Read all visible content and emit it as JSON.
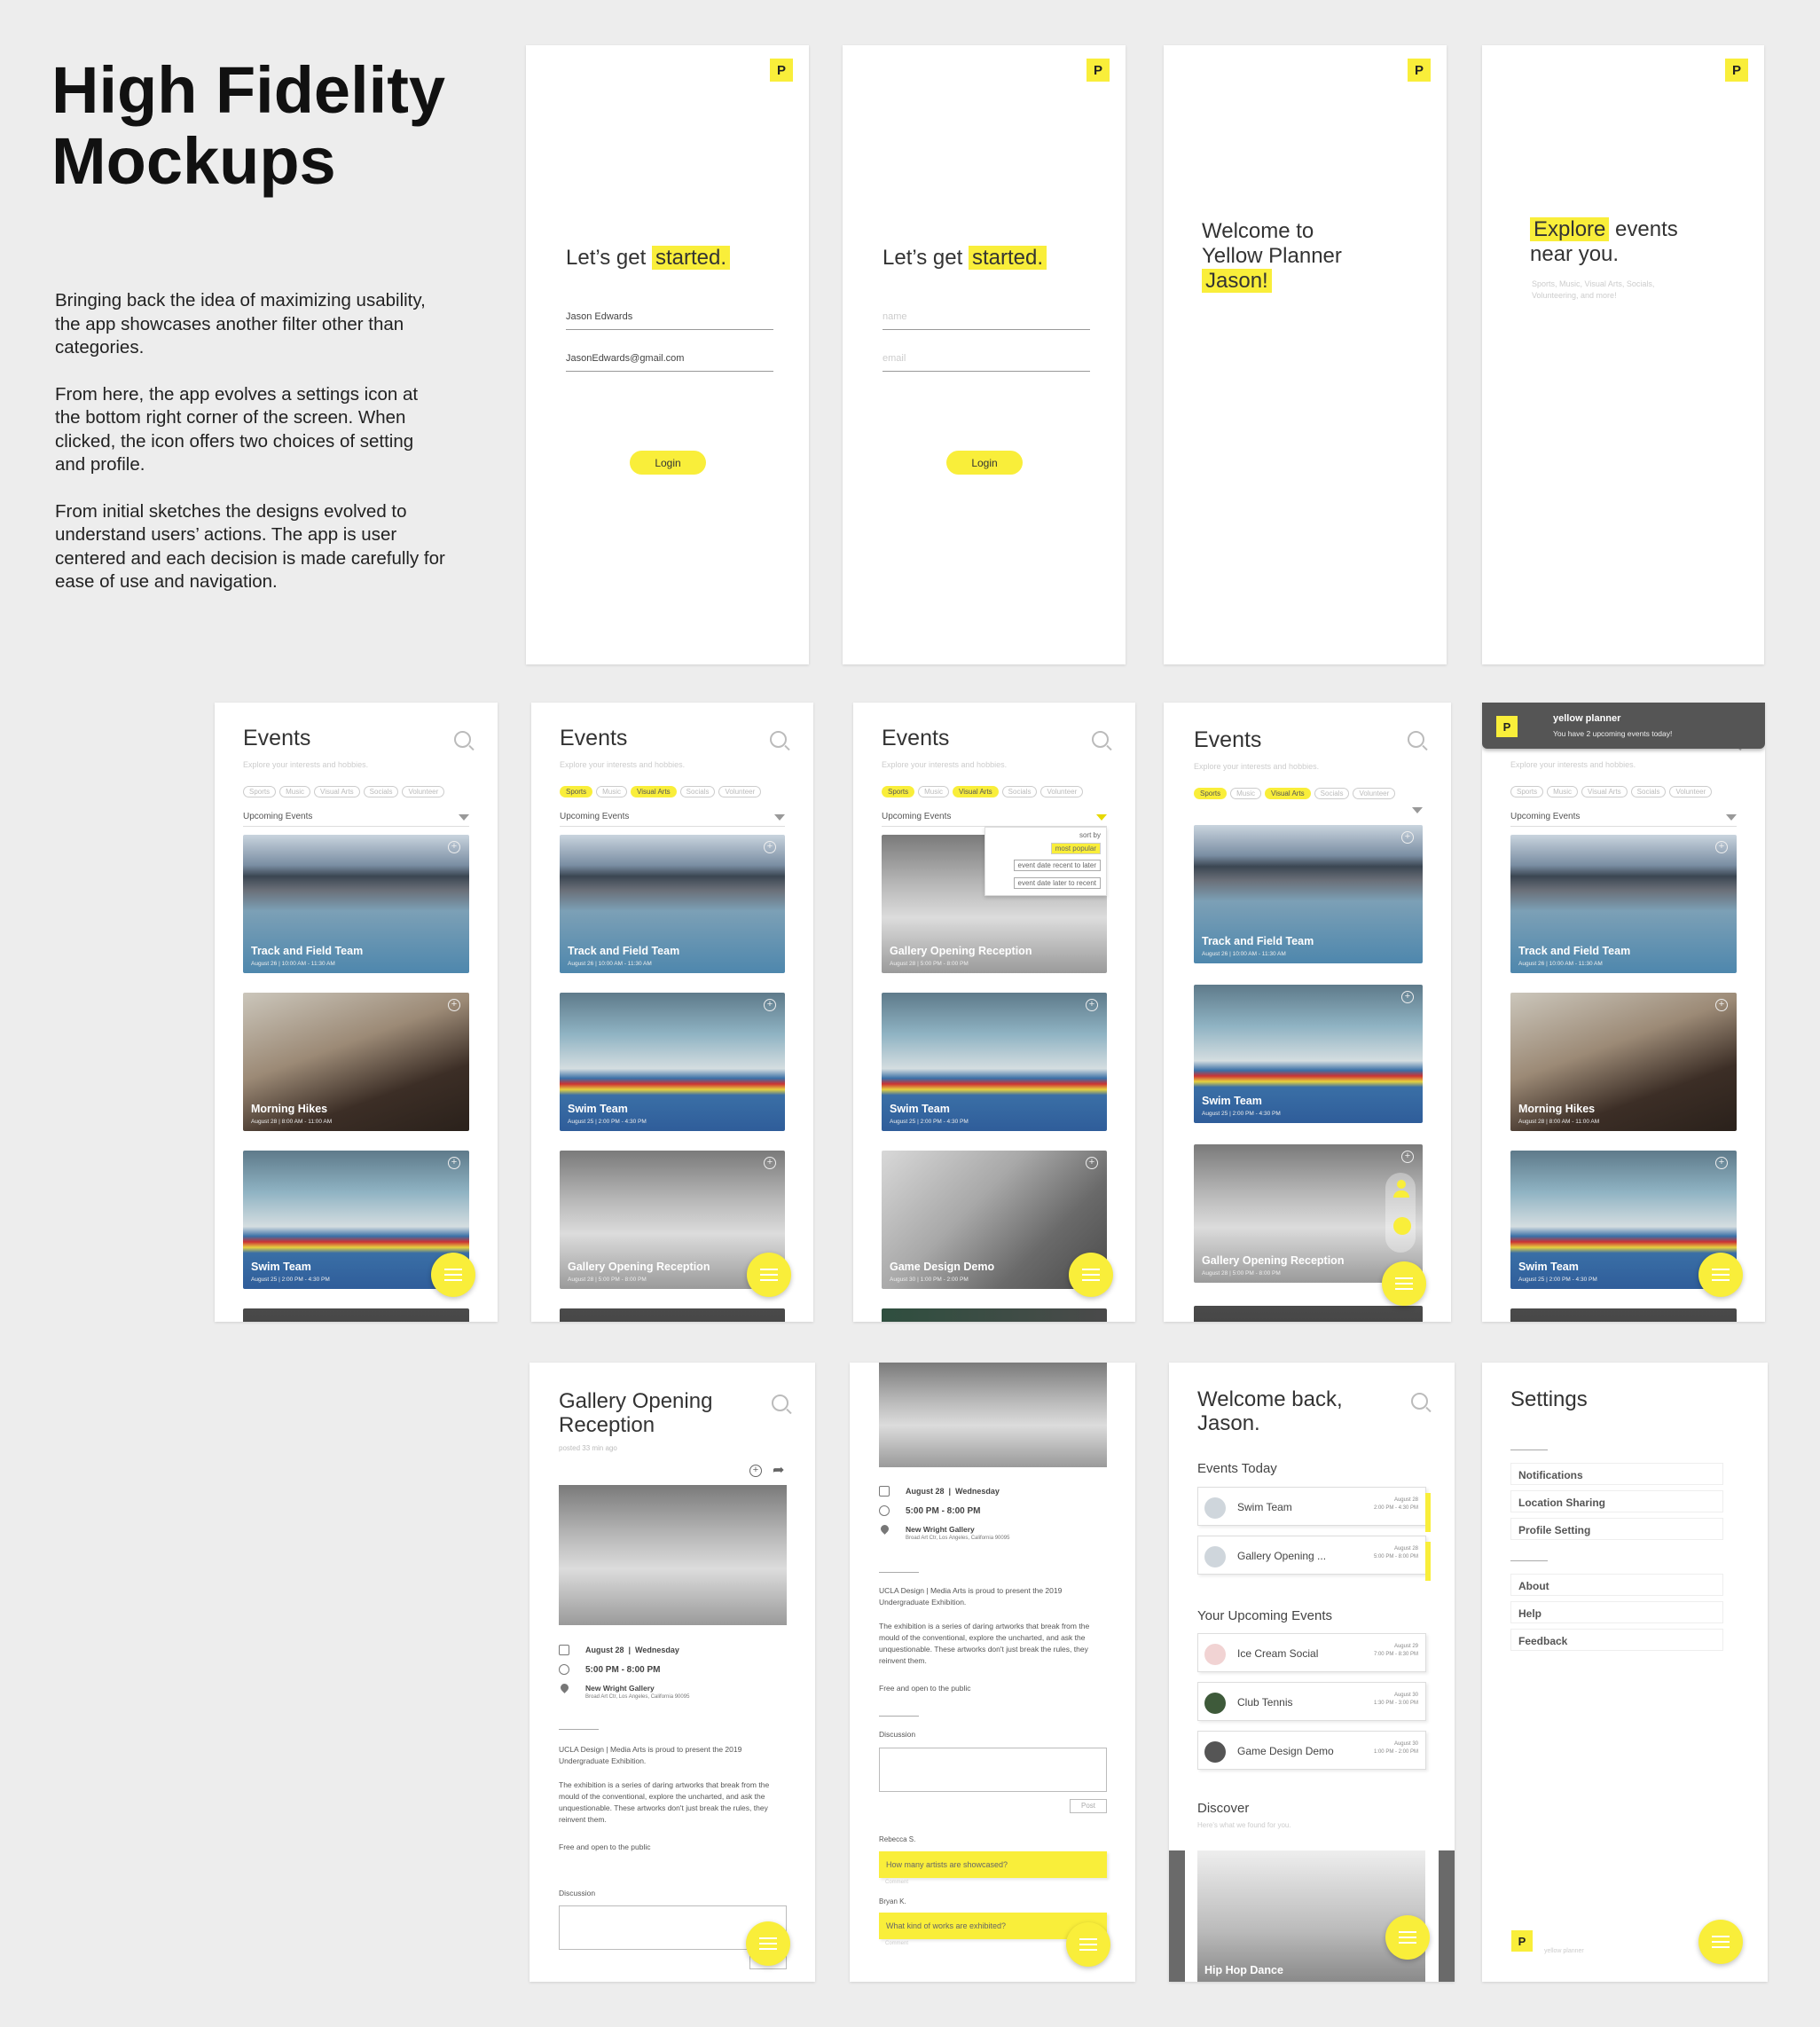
{
  "intro": {
    "title_line1": "High Fidelity",
    "title_line2": "Mockups",
    "p1": "Bringing back the idea of maximizing usability, the app showcases another filter other than categories.",
    "p2": "From here, the app evolves a settings icon at the bottom right corner of the screen. When clicked, the icon offers two choices of setting and profile.",
    "p3": "From initial sketches the designs evolved to understand users’ actions. The app is user centered and each decision is made carefully for ease of use and navigation."
  },
  "logo": "P",
  "login": {
    "heading_pre": "Let’s get",
    "heading_hl": "started.",
    "name_value": "Jason Edwards",
    "email_value": "JasonEdwards@gmail.com",
    "name_placeholder": "name",
    "email_placeholder": "email",
    "button": "Login"
  },
  "welcome": {
    "line1": "Welcome to",
    "line2": "Yellow Planner",
    "name": "Jason!"
  },
  "explore": {
    "hl": "Explore",
    "rest": "events",
    "line2": "near you.",
    "sub": "Sports, Music, Visual Arts, Socials, Volunteering, and more!"
  },
  "events": {
    "title": "Events",
    "subtitle": "Explore your interests and hobbies.",
    "chips": [
      "Sports",
      "Music",
      "Visual Arts",
      "Socials",
      "Volunteer"
    ],
    "upcoming": "Upcoming Events",
    "sort_by": "sort by",
    "sort_options": [
      "most popular",
      "event date recent to later",
      "event date later to recent"
    ],
    "cards": {
      "track": {
        "name": "Track and Field Team",
        "date": "August 26   |   10:00 AM - 11:30 AM"
      },
      "hike": {
        "name": "Morning Hikes",
        "date": "August 28   |   8:00 AM - 11:00 AM"
      },
      "swim": {
        "name": "Swim Team",
        "date": "August 25   |   2:00 PM - 4:30 PM"
      },
      "gallery": {
        "name": "Gallery Opening Reception",
        "date": "August 28   |   5:00 PM - 8:00 PM"
      },
      "game": {
        "name": "Game Design Demo",
        "date": "August 30   |   1:00 PM - 2:00 PM"
      }
    }
  },
  "notification": {
    "app": "yellow planner",
    "message": "You have 2 upcoming events today!"
  },
  "detail": {
    "title_line1": "Gallery Opening",
    "title_line2": "Reception",
    "posted": "posted 33 min ago",
    "date": "August 28",
    "weekday": "Wednesday",
    "time": "5:00 PM - 8:00 PM",
    "venue": "New Wright Gallery",
    "address": "Broad Art Ctr, Los Angeles, California 90095",
    "p1": "UCLA Design | Media Arts is proud to present the 2019 Undergraduate Exhibition.",
    "p2": "The exhibition is a series of daring artworks that break from the mould of the conventional, explore the uncharted, and ask the unquestionable. These artworks don't just break the rules, they reinvent them.",
    "p3": "Free and open to the public",
    "discussion": "Discussion",
    "post": "Post",
    "comments": [
      {
        "user": "Rebecca S.",
        "text": "How many artists are showcased?",
        "action": "Comment"
      },
      {
        "user": "Bryan K.",
        "text": "What kind of works are exhibited?",
        "action": "Comment"
      }
    ]
  },
  "home": {
    "line1": "Welcome back,",
    "line2": "Jason.",
    "today": "Events Today",
    "today_events": [
      {
        "name": "Swim Team",
        "date": "August 28",
        "time": "2:00 PM - 4:30 PM"
      },
      {
        "name": "Gallery Opening ...",
        "date": "August 28",
        "time": "5:00 PM - 8:00 PM"
      }
    ],
    "upcoming": "Your Upcoming Events",
    "upcoming_events": [
      {
        "name": "Ice Cream Social",
        "date": "August 29",
        "time": "7:00 PM - 8:30 PM"
      },
      {
        "name": "Club Tennis",
        "date": "August 30",
        "time": "1:30 PM - 3:00 PM"
      },
      {
        "name": "Game Design Demo",
        "date": "August 30",
        "time": "1:00 PM - 2:00 PM"
      }
    ],
    "discover": "Discover",
    "discover_sub": "Here's what we found for you.",
    "discover_card": "Hip Hop Dance"
  },
  "settings": {
    "title": "Settings",
    "group1": [
      "Notifications",
      "Location Sharing",
      "Profile Setting"
    ],
    "group2": [
      "About",
      "Help",
      "Feedback"
    ],
    "footer": "yellow planner"
  },
  "colors": {
    "accent": "#f9ee3a",
    "background": "#ededed"
  }
}
